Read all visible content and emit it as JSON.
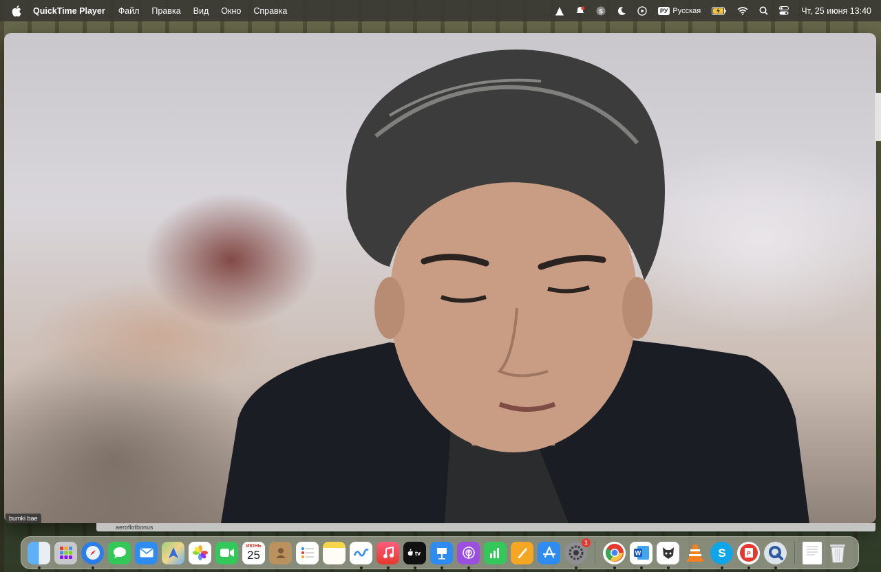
{
  "menubar": {
    "app_name": "QuickTime Player",
    "menus": [
      "Файл",
      "Правка",
      "Вид",
      "Окно",
      "Справка"
    ],
    "keyboard_badge": "РУ",
    "keyboard_language": "Русская",
    "datetime": "Чт, 25 июня  13:40",
    "icons": [
      "apple-icon",
      "cone-icon",
      "bell-icon",
      "skype-menubar-icon",
      "moon-icon",
      "play-circle-icon",
      "battery-icon",
      "wifi-icon",
      "search-icon",
      "control-center-icon"
    ]
  },
  "video": {
    "participant_name": "bumki bae"
  },
  "background_window": {
    "tab_label": "aeroflotbonus"
  },
  "dock": {
    "calendar_month": "ИЮНЬ",
    "calendar_day": "25",
    "system_settings_badge": "1",
    "apps": [
      "Finder",
      "Launchpad",
      "Safari",
      "Messages",
      "Mail",
      "Maps",
      "Photos",
      "FaceTime",
      "Calendar",
      "Contacts",
      "Reminders",
      "Notes",
      "Freeform",
      "Music",
      "TV",
      "Keynote",
      "Podcasts",
      "Numbers",
      "Pages",
      "App Store",
      "System Settings",
      "Chrome",
      "Word",
      "VPN",
      "VLC",
      "Skype",
      "PDF",
      "QuickTime",
      "Document",
      "Trash"
    ]
  },
  "colors": {
    "menubar_bg": "#3a3a34",
    "badge_red": "#e5392f"
  }
}
